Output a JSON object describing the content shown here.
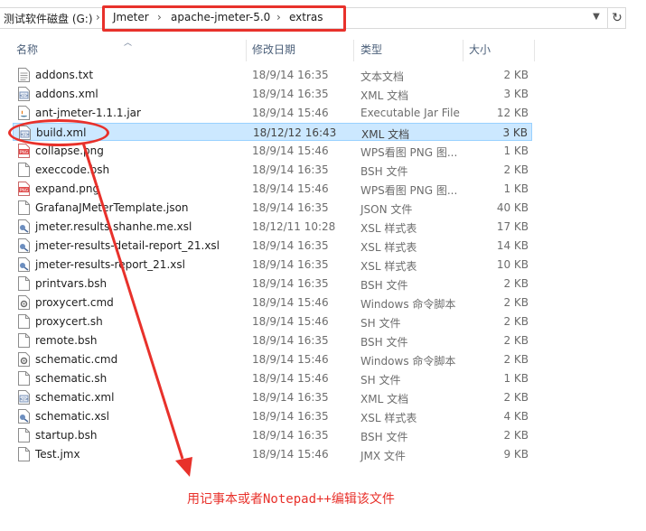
{
  "address": {
    "root": "测试软件磁盘 (G:)",
    "crumbs": [
      "Jmeter",
      "apache-jmeter-5.0",
      "extras"
    ],
    "separator": "›"
  },
  "columns": {
    "name": "名称",
    "date": "修改日期",
    "type": "类型",
    "size": "大小"
  },
  "files": [
    {
      "name": "addons.txt",
      "date": "18/9/14 16:35",
      "type": "文本文档",
      "size": "2 KB",
      "icon": "text-file-icon"
    },
    {
      "name": "addons.xml",
      "date": "18/9/14 16:35",
      "type": "XML 文档",
      "size": "3 KB",
      "icon": "xml-file-icon"
    },
    {
      "name": "ant-jmeter-1.1.1.jar",
      "date": "18/9/14 15:46",
      "type": "Executable Jar File",
      "size": "12 KB",
      "icon": "jar-file-icon"
    },
    {
      "name": "build.xml",
      "date": "18/12/12 16:43",
      "type": "XML 文档",
      "size": "3 KB",
      "icon": "xml-file-icon",
      "selected": true
    },
    {
      "name": "collapse.png",
      "date": "18/9/14 15:46",
      "type": "WPS看图 PNG 图...",
      "size": "1 KB",
      "icon": "png-file-icon"
    },
    {
      "name": "execcode.bsh",
      "date": "18/9/14 16:35",
      "type": "BSH 文件",
      "size": "2 KB",
      "icon": "generic-file-icon"
    },
    {
      "name": "expand.png",
      "date": "18/9/14 15:46",
      "type": "WPS看图 PNG 图...",
      "size": "1 KB",
      "icon": "png-file-icon"
    },
    {
      "name": "GrafanaJMeterTemplate.json",
      "date": "18/9/14 16:35",
      "type": "JSON 文件",
      "size": "40 KB",
      "icon": "generic-file-icon"
    },
    {
      "name": "jmeter.results.shanhe.me.xsl",
      "date": "18/12/11 10:28",
      "type": "XSL 样式表",
      "size": "17 KB",
      "icon": "xsl-file-icon"
    },
    {
      "name": "jmeter-results-detail-report_21.xsl",
      "date": "18/9/14 16:35",
      "type": "XSL 样式表",
      "size": "14 KB",
      "icon": "xsl-file-icon"
    },
    {
      "name": "jmeter-results-report_21.xsl",
      "date": "18/9/14 16:35",
      "type": "XSL 样式表",
      "size": "10 KB",
      "icon": "xsl-file-icon"
    },
    {
      "name": "printvars.bsh",
      "date": "18/9/14 16:35",
      "type": "BSH 文件",
      "size": "2 KB",
      "icon": "generic-file-icon"
    },
    {
      "name": "proxycert.cmd",
      "date": "18/9/14 15:46",
      "type": "Windows 命令脚本",
      "size": "2 KB",
      "icon": "cmd-file-icon"
    },
    {
      "name": "proxycert.sh",
      "date": "18/9/14 15:46",
      "type": "SH 文件",
      "size": "2 KB",
      "icon": "generic-file-icon"
    },
    {
      "name": "remote.bsh",
      "date": "18/9/14 16:35",
      "type": "BSH 文件",
      "size": "2 KB",
      "icon": "generic-file-icon"
    },
    {
      "name": "schematic.cmd",
      "date": "18/9/14 15:46",
      "type": "Windows 命令脚本",
      "size": "2 KB",
      "icon": "cmd-file-icon"
    },
    {
      "name": "schematic.sh",
      "date": "18/9/14 15:46",
      "type": "SH 文件",
      "size": "1 KB",
      "icon": "generic-file-icon"
    },
    {
      "name": "schematic.xml",
      "date": "18/9/14 16:35",
      "type": "XML 文档",
      "size": "2 KB",
      "icon": "xml-file-icon"
    },
    {
      "name": "schematic.xsl",
      "date": "18/9/14 16:35",
      "type": "XSL 样式表",
      "size": "4 KB",
      "icon": "xsl-file-icon"
    },
    {
      "name": "startup.bsh",
      "date": "18/9/14 16:35",
      "type": "BSH 文件",
      "size": "2 KB",
      "icon": "generic-file-icon"
    },
    {
      "name": "Test.jmx",
      "date": "18/9/14 15:46",
      "type": "JMX 文件",
      "size": "9 KB",
      "icon": "generic-file-icon"
    }
  ],
  "annotation": {
    "note": "用记事本或者Notepad++编辑该文件",
    "color": "#e8312b"
  },
  "colors": {
    "selection_bg": "#cce8ff",
    "selection_border": "#99d1ff",
    "header_text": "#4c607a"
  }
}
